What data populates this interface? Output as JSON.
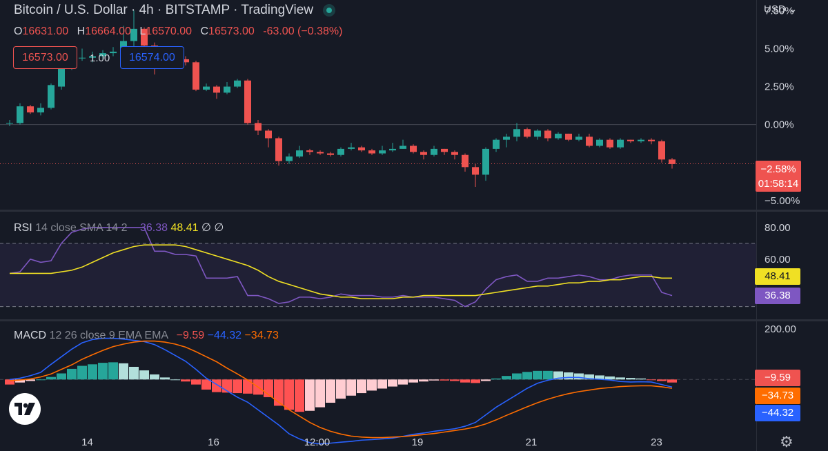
{
  "header": {
    "title": "Bitcoin / U.S. Dollar · 4h · BITSTAMP · TradingView",
    "currency": "USD",
    "ohlc": [
      {
        "k": "O",
        "v": "16631.00"
      },
      {
        "k": "H",
        "v": "16664.00"
      },
      {
        "k": "L",
        "v": "16570.00"
      },
      {
        "k": "C",
        "v": "16573.00"
      },
      {
        "k": "",
        "v": "-63.00 (−0.38%)"
      }
    ],
    "sell_price": "16573.00",
    "spread": "1.00",
    "buy_price": "16574.00"
  },
  "price_tag": {
    "pct": "−2.58%",
    "countdown": "01:58:14"
  },
  "rsi_label": {
    "name": "RSI",
    "params": "14 close SMA 14 2",
    "v1": "36.38",
    "v2": "48.41",
    "v3": "∅",
    "v4": "∅"
  },
  "macd_label": {
    "name": "MACD",
    "params": "12 26 close 9 EMA EMA",
    "v1": "−9.59",
    "v2": "−44.32",
    "v3": "−34.73"
  },
  "rsi_tags": {
    "ma": "48.41",
    "rsi": "36.38"
  },
  "macd_tags": {
    "hist": "−9.59",
    "signal": "−34.73",
    "macd": "−44.32"
  },
  "colors": {
    "up": "#26a69a",
    "down": "#ef5350",
    "rsi": "#7e57c2",
    "rsi_ma": "#f0e024",
    "macd": "#2962ff",
    "signal": "#ff6d00",
    "bg": "#161a25",
    "grid_text": "#d1d4dc"
  },
  "chart_data": [
    {
      "type": "candlestick",
      "title": "Bitcoin / U.S. Dollar · 4h · BITSTAMP",
      "y_unit": "% change",
      "ylim": [
        -5.6,
        8.2
      ],
      "y_ticks": [
        "7.50%",
        "5.00%",
        "2.50%",
        "0.00%",
        "−5.00%"
      ],
      "y_tick_values": [
        7.5,
        5.0,
        2.5,
        0.0,
        -5.0
      ],
      "x_ticks": [
        "14",
        "16",
        "12:00",
        "19",
        "21",
        "23"
      ],
      "x_tick_index": [
        7.5,
        19.7,
        29.7,
        39.4,
        50.4,
        62.5
      ],
      "last_value": -2.58,
      "candles": [
        [
          0.1,
          0.1,
          0.3,
          -0.1
        ],
        [
          0.1,
          1.2,
          1.4,
          0.0
        ],
        [
          1.2,
          0.8,
          1.3,
          0.7
        ],
        [
          0.8,
          1.1,
          1.4,
          0.6
        ],
        [
          1.1,
          2.6,
          2.7,
          1.0
        ],
        [
          2.5,
          4.0,
          4.9,
          2.3
        ],
        [
          4.0,
          4.4,
          4.6,
          3.6
        ],
        [
          4.4,
          4.4,
          5.0,
          4.2
        ],
        [
          4.4,
          4.5,
          4.8,
          4.1
        ],
        [
          4.5,
          4.7,
          4.9,
          4.3
        ],
        [
          4.7,
          4.8,
          5.1,
          4.5
        ],
        [
          4.8,
          5.5,
          6.5,
          4.6
        ],
        [
          5.5,
          6.3,
          7.5,
          5.1
        ],
        [
          6.3,
          5.2,
          6.4,
          4.5
        ],
        [
          5.2,
          4.3,
          5.4,
          3.3
        ],
        [
          4.3,
          4.1,
          4.6,
          3.7
        ],
        [
          4.1,
          4.3,
          4.7,
          3.8
        ],
        [
          4.3,
          4.1,
          4.5,
          3.9
        ],
        [
          4.1,
          2.3,
          4.2,
          2.2
        ],
        [
          2.3,
          2.5,
          2.7,
          2.2
        ],
        [
          2.5,
          2.1,
          2.6,
          1.7
        ],
        [
          2.1,
          2.5,
          2.8,
          2.0
        ],
        [
          2.5,
          2.9,
          3.0,
          2.4
        ],
        [
          2.9,
          0.1,
          3.0,
          0.0
        ],
        [
          0.1,
          -0.4,
          0.3,
          -0.7
        ],
        [
          -0.4,
          -0.9,
          -0.3,
          -1.5
        ],
        [
          -0.9,
          -2.4,
          -0.8,
          -2.7
        ],
        [
          -2.4,
          -2.1,
          -1.9,
          -2.6
        ],
        [
          -2.1,
          -1.7,
          -1.4,
          -2.2
        ],
        [
          -1.7,
          -1.8,
          -1.6,
          -2.0
        ],
        [
          -1.8,
          -1.9,
          -1.7,
          -2.0
        ],
        [
          -1.9,
          -2.0,
          -1.8,
          -2.1
        ],
        [
          -2.0,
          -1.6,
          -1.5,
          -2.1
        ],
        [
          -1.6,
          -1.5,
          -1.2,
          -1.7
        ],
        [
          -1.5,
          -1.7,
          -1.4,
          -1.8
        ],
        [
          -1.7,
          -1.9,
          -1.6,
          -2.0
        ],
        [
          -1.9,
          -1.7,
          -1.4,
          -2.0
        ],
        [
          -1.7,
          -1.6,
          -1.2,
          -1.8
        ],
        [
          -1.6,
          -1.4,
          -1.0,
          -1.6
        ],
        [
          -1.4,
          -1.8,
          -1.3,
          -1.9
        ],
        [
          -1.8,
          -2.0,
          -1.7,
          -2.3
        ],
        [
          -2.0,
          -1.6,
          -1.4,
          -2.1
        ],
        [
          -1.6,
          -1.8,
          -1.6,
          -2.0
        ],
        [
          -1.8,
          -2.0,
          -1.7,
          -2.3
        ],
        [
          -2.0,
          -2.8,
          -1.9,
          -3.1
        ],
        [
          -2.8,
          -3.3,
          -2.6,
          -4.1
        ],
        [
          -3.3,
          -1.6,
          -1.5,
          -3.7
        ],
        [
          -1.6,
          -1.0,
          -0.9,
          -1.8
        ],
        [
          -1.0,
          -0.8,
          -0.6,
          -1.5
        ],
        [
          -0.8,
          -0.3,
          0.1,
          -1.1
        ],
        [
          -0.3,
          -0.8,
          -0.2,
          -0.9
        ],
        [
          -0.8,
          -0.4,
          -0.3,
          -1.0
        ],
        [
          -0.4,
          -0.9,
          -0.3,
          -1.1
        ],
        [
          -0.9,
          -0.6,
          -0.5,
          -1.0
        ],
        [
          -0.6,
          -1.0,
          -0.6,
          -1.1
        ],
        [
          -1.0,
          -0.8,
          -0.6,
          -1.1
        ],
        [
          -0.8,
          -1.4,
          -0.6,
          -1.5
        ],
        [
          -1.4,
          -1.0,
          -0.9,
          -1.5
        ],
        [
          -1.0,
          -1.5,
          -0.9,
          -1.6
        ],
        [
          -1.5,
          -1.0,
          -0.9,
          -1.6
        ],
        [
          -1.0,
          -1.1,
          -1.0,
          -1.2
        ],
        [
          -1.1,
          -1.0,
          -0.9,
          -1.2
        ],
        [
          -1.0,
          -1.1,
          -0.9,
          -1.3
        ],
        [
          -1.1,
          -2.3,
          -1.0,
          -2.5
        ],
        [
          -2.3,
          -2.6,
          -2.2,
          -2.9
        ]
      ]
    },
    {
      "type": "line",
      "title": "RSI 14 close SMA 14 2",
      "ylim": [
        22,
        90
      ],
      "y_ticks": [
        "80.00",
        "60.00"
      ],
      "y_tick_values": [
        80,
        60
      ],
      "bands": [
        70,
        30
      ],
      "series": [
        {
          "name": "RSI",
          "color": "#7e57c2",
          "values": [
            51,
            52,
            60,
            58,
            59,
            70,
            77,
            79,
            80,
            80,
            80,
            80,
            80,
            80,
            65,
            65,
            63,
            63,
            62,
            48,
            48,
            48,
            49,
            37,
            37,
            35,
            32,
            33,
            36,
            36,
            35,
            36,
            38,
            37,
            37,
            37,
            36,
            36,
            37,
            36,
            36,
            36,
            35,
            34,
            30,
            33,
            41,
            47,
            49,
            50,
            46,
            46,
            48,
            48,
            49,
            50,
            49,
            47,
            47,
            49,
            50,
            50,
            50,
            39,
            37
          ]
        },
        {
          "name": "MA",
          "color": "#f0e024",
          "values": [
            51,
            51,
            51,
            51,
            51,
            52,
            53,
            55,
            58,
            61,
            64,
            66,
            68,
            69,
            69,
            69,
            69,
            68,
            66,
            64,
            62,
            60,
            58,
            56,
            53,
            49,
            46,
            44,
            42,
            40,
            38,
            37,
            36,
            36,
            35,
            35,
            35,
            35,
            36,
            36,
            37,
            37,
            37,
            37,
            37,
            37,
            38,
            39,
            40,
            41,
            42,
            43,
            43,
            44,
            45,
            45,
            46,
            46,
            47,
            47,
            48,
            49,
            49,
            48,
            48
          ]
        }
      ]
    },
    {
      "type": "bar",
      "title": "MACD 12 26 close 9 EMA EMA",
      "ylim": [
        -283,
        230
      ],
      "y_ticks": [
        "200.00"
      ],
      "y_tick_values": [
        200
      ],
      "series": [
        {
          "name": "Histogram",
          "values": [
            -20,
            -12,
            -6,
            0,
            10,
            24,
            42,
            54,
            60,
            66,
            68,
            64,
            50,
            36,
            20,
            8,
            0,
            -8,
            -20,
            -40,
            -50,
            -52,
            -54,
            -56,
            -60,
            -70,
            -104,
            -120,
            -128,
            -124,
            -110,
            -92,
            -76,
            -64,
            -54,
            -44,
            -36,
            -28,
            -20,
            -12,
            -8,
            -4,
            -4,
            -6,
            -12,
            -14,
            -6,
            4,
            14,
            24,
            30,
            34,
            34,
            32,
            28,
            24,
            20,
            16,
            12,
            8,
            6,
            4,
            -1,
            -6,
            -12
          ]
        },
        {
          "name": "MACD",
          "color": "#2962ff",
          "values": [
            0,
            5,
            15,
            28,
            60,
            90,
            120,
            145,
            158,
            163,
            163,
            160,
            155,
            150,
            138,
            118,
            95,
            72,
            40,
            5,
            -20,
            -45,
            -70,
            -90,
            -120,
            -150,
            -180,
            -215,
            -235,
            -250,
            -255,
            -252,
            -248,
            -245,
            -240,
            -238,
            -235,
            -232,
            -225,
            -217,
            -212,
            -205,
            -200,
            -195,
            -185,
            -170,
            -140,
            -110,
            -85,
            -60,
            -35,
            -15,
            -3,
            5,
            8,
            8,
            3,
            1,
            -2,
            -8,
            -10,
            -9,
            -10,
            -20,
            -30
          ]
        },
        {
          "name": "Signal",
          "color": "#ff6d00",
          "values": [
            -5,
            -2,
            2,
            10,
            22,
            40,
            58,
            80,
            98,
            115,
            130,
            140,
            148,
            152,
            152,
            148,
            140,
            128,
            110,
            90,
            70,
            45,
            22,
            -2,
            -30,
            -60,
            -90,
            -120,
            -145,
            -170,
            -190,
            -205,
            -216,
            -224,
            -228,
            -230,
            -230,
            -228,
            -226,
            -222,
            -218,
            -214,
            -208,
            -202,
            -196,
            -188,
            -176,
            -160,
            -142,
            -125,
            -108,
            -92,
            -78,
            -66,
            -56,
            -48,
            -42,
            -36,
            -32,
            -28,
            -26,
            -25,
            -25,
            -29,
            -35
          ]
        }
      ]
    }
  ]
}
